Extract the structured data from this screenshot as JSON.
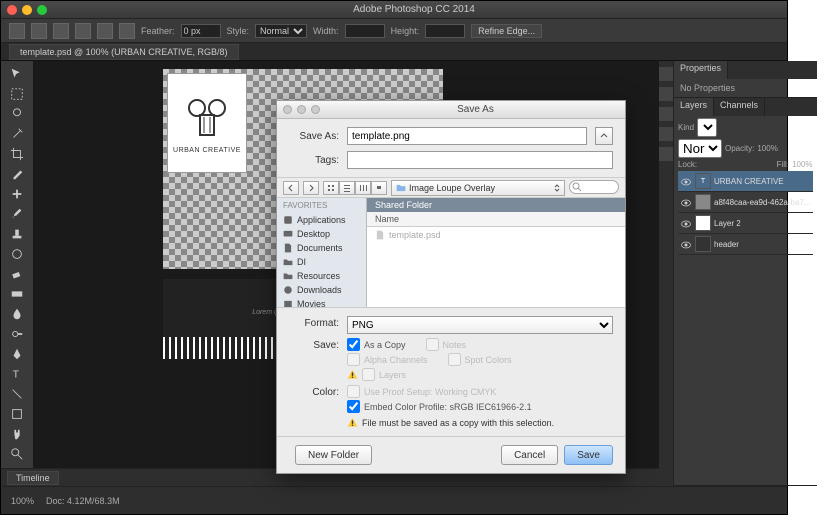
{
  "app": {
    "title": "Adobe Photoshop CC 2014"
  },
  "optionbar": {
    "feather_label": "Feather:",
    "feather_value": "0 px",
    "style_label": "Style:",
    "style_value": "Normal",
    "width_label": "Width:",
    "height_label": "Height:",
    "refine_label": "Refine Edge..."
  },
  "document": {
    "tab": "template.psd @ 100% (URBAN CREATIVE, RGB/8)"
  },
  "canvas": {
    "logo_text": "URBAN CREATIVE",
    "lorem": "Lorem ipsum delor sodat sit amet consectetur"
  },
  "status": {
    "zoom": "100%",
    "docinfo": "Doc: 4.12M/68.3M",
    "timeline": "Timeline"
  },
  "panels": {
    "properties_tab": "Properties",
    "properties_text": "No Properties",
    "layers_tab": "Layers",
    "channels_tab": "Channels",
    "kind_label": "Kind",
    "blend_mode": "Normal",
    "opacity_label": "Opacity:",
    "opacity_value": "100%",
    "lock_label": "Lock:",
    "fill_label": "Fill:",
    "fill_value": "100%",
    "layers": [
      {
        "name": "URBAN CREATIVE"
      },
      {
        "name": "a8f48caa-ea9d-462a-ba7..."
      },
      {
        "name": "Layer 2"
      },
      {
        "name": "header"
      }
    ]
  },
  "dialog": {
    "title": "Save As",
    "save_as_label": "Save As:",
    "save_as_value": "template.png",
    "tags_label": "Tags:",
    "tags_value": "",
    "sidebar_header": "FAVORITES",
    "sidebar_items": [
      "Applications",
      "Desktop",
      "Documents",
      "DI",
      "Resources",
      "Downloads",
      "Movies"
    ],
    "folder_name": "Image Loupe Overlay",
    "shared_header": "Shared Folder",
    "column_name": "Name",
    "files": [
      "template.psd"
    ],
    "format_label": "Format:",
    "format_value": "PNG",
    "save_label": "Save:",
    "opt_as_copy": "As a Copy",
    "opt_notes": "Notes",
    "opt_alpha": "Alpha Channels",
    "opt_spot": "Spot Colors",
    "opt_layers": "Layers",
    "color_label": "Color:",
    "opt_proof": "Use Proof Setup:  Working CMYK",
    "opt_embed": "Embed Color Profile:  sRGB IEC61966-2.1",
    "warn_text": "File must be saved as a copy with this selection.",
    "new_folder_btn": "New Folder",
    "cancel_btn": "Cancel",
    "save_btn": "Save"
  }
}
